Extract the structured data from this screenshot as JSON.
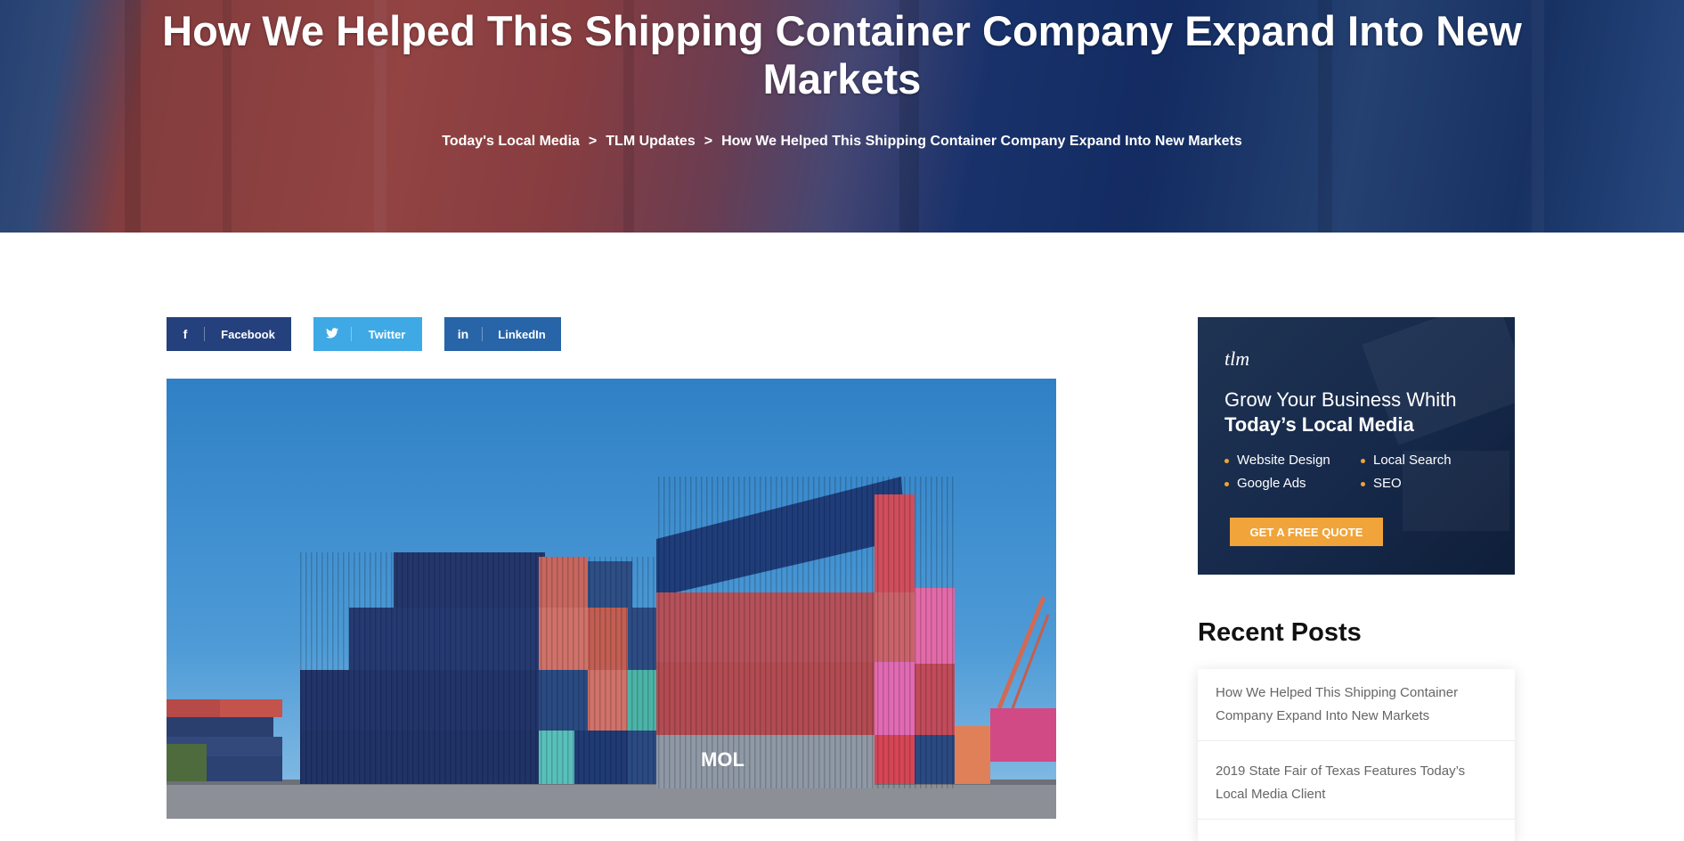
{
  "hero": {
    "title": "How We Helped This Shipping Container Company Expand Into New Markets",
    "breadcrumb": {
      "items": [
        "Today's Local Media",
        "TLM Updates",
        "How We Helped This Shipping Container Company Expand Into New Markets"
      ],
      "separator": ">"
    }
  },
  "share": {
    "facebook": {
      "icon": "f",
      "label": "Facebook",
      "color": "#24417d"
    },
    "twitter": {
      "icon": "twitter-bird",
      "label": "Twitter",
      "color": "#3ea9e5"
    },
    "linkedin": {
      "icon": "in",
      "label": "LinkedIn",
      "color": "#2864a8"
    }
  },
  "ad": {
    "logo_text": "tlm",
    "headline_line1": "Grow Your Business Whith",
    "headline_line2": "Today’s Local Media",
    "features": [
      "Website Design",
      "Local Search",
      "Google Ads",
      "SEO"
    ],
    "cta": "GET A FREE QUOTE",
    "accent_color": "#f0a43a"
  },
  "recent_posts": {
    "title": "Recent Posts",
    "items": [
      "How We Helped This Shipping Container Company Expand Into New Markets",
      "2019 State Fair of Texas Features Today’s Local Media Client"
    ]
  },
  "photo": {
    "container_text_left": "MOL"
  }
}
